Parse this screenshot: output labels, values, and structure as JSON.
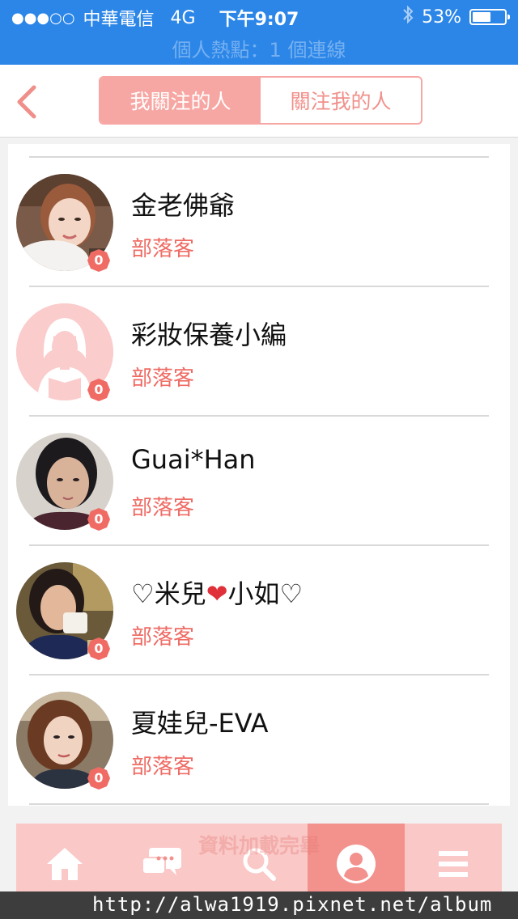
{
  "status_bar": {
    "signal": "●●●○○",
    "carrier": "中華電信",
    "network": "4G",
    "time": "下午9:07",
    "battery": "53%",
    "battery_level": 0.53,
    "hotspot": "個人熱點：1 個連線"
  },
  "header": {
    "tabs": [
      {
        "label": "我關注的人",
        "active": true
      },
      {
        "label": "關注我的人",
        "active": false
      }
    ]
  },
  "list": {
    "items": [
      {
        "name": "金老佛爺",
        "role": "部落客",
        "badge": "0"
      },
      {
        "name": "彩妝保養小編",
        "role": "部落客",
        "badge": "0"
      },
      {
        "name": "Guai*Han",
        "role": "部落客",
        "badge": "0"
      },
      {
        "name": "♡米兒",
        "name_emoji": "❤",
        "name_rest": "小如♡",
        "role": "部落客",
        "badge": "0"
      },
      {
        "name": "夏娃兒-EVA",
        "role": "部落客",
        "badge": "0"
      }
    ]
  },
  "toast": "資料加載完畢",
  "tabbar": {
    "items": [
      "home-icon",
      "chat-icon",
      "search-icon",
      "profile-icon",
      "menu-icon"
    ],
    "active_index": 3
  },
  "watermark": "http://alwa1919.pixnet.net/album",
  "colors": {
    "status_bar_bg": "#2b86e8",
    "accent_pink": "#f7a7a3",
    "role_text": "#ef6b64",
    "tabbar_bg": "#f9c8c7",
    "tabbar_active": "#f3918d"
  }
}
